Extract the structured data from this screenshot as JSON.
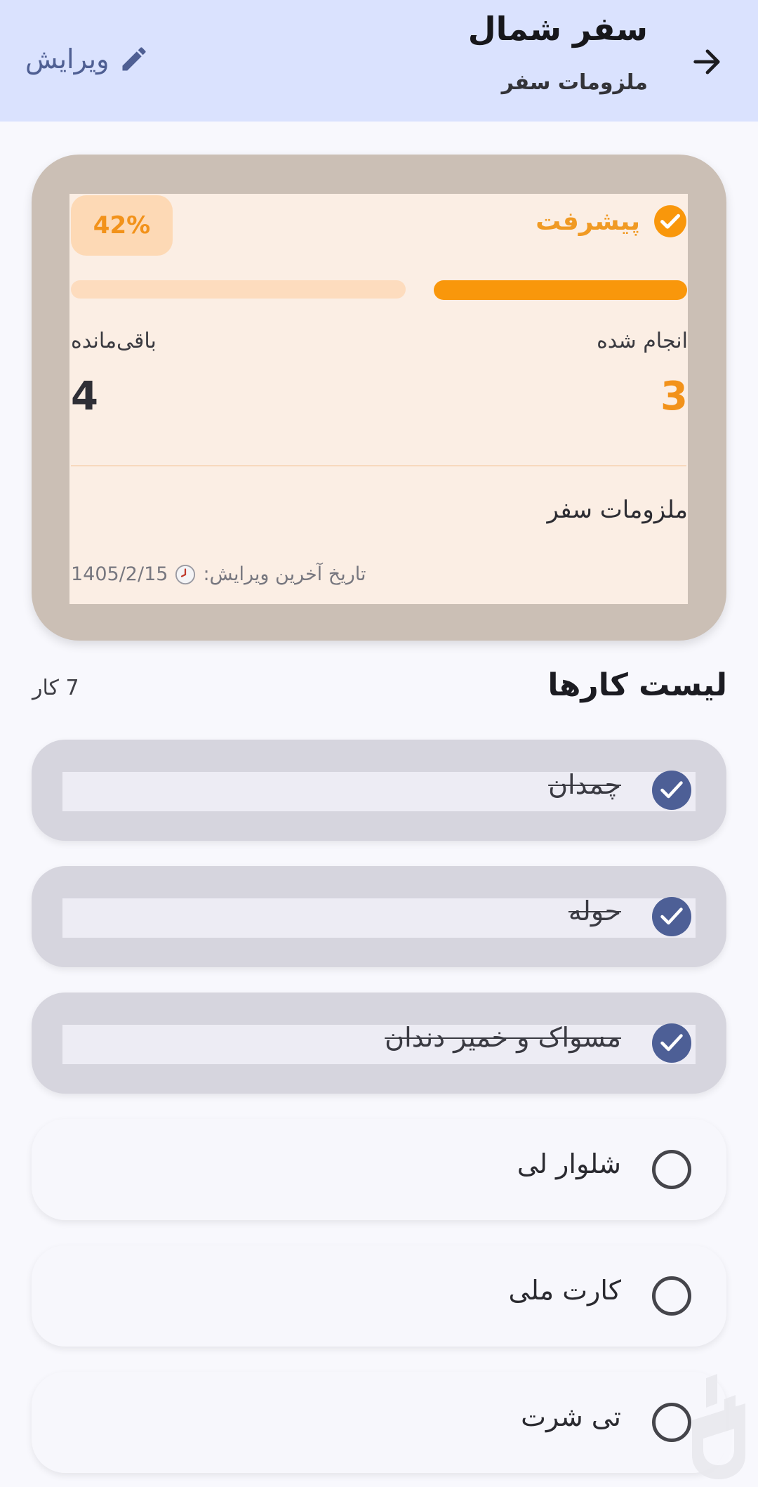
{
  "appbar": {
    "title": "سفر شمال",
    "subtitle": "ملزومات سفر",
    "edit_label": "ویرایش",
    "back_icon": "arrow-back-icon",
    "edit_icon": "pencil-icon"
  },
  "progress_card": {
    "label": "پیشرفت",
    "percent_text": "42%",
    "progress_fraction": 0.42,
    "done_label": "انجام شده",
    "done_value": "3",
    "remaining_label": "باقی‌مانده",
    "remaining_value": "4",
    "description": "ملزومات سفر",
    "last_edit_label": "تاریخ آخرین ویرایش:",
    "last_edit_date": "1405/2/15",
    "accent_color": "#f9970b"
  },
  "task_list": {
    "title": "لیست کارها",
    "count_text": "7 کار",
    "items": [
      {
        "label": "چمدان",
        "done": true
      },
      {
        "label": "حوله",
        "done": true
      },
      {
        "label": "مسواک و خمیر دندان",
        "done": true
      },
      {
        "label": "شلوار لی",
        "done": false
      },
      {
        "label": "کارت ملی",
        "done": false
      },
      {
        "label": "تی شرت",
        "done": false
      }
    ]
  }
}
